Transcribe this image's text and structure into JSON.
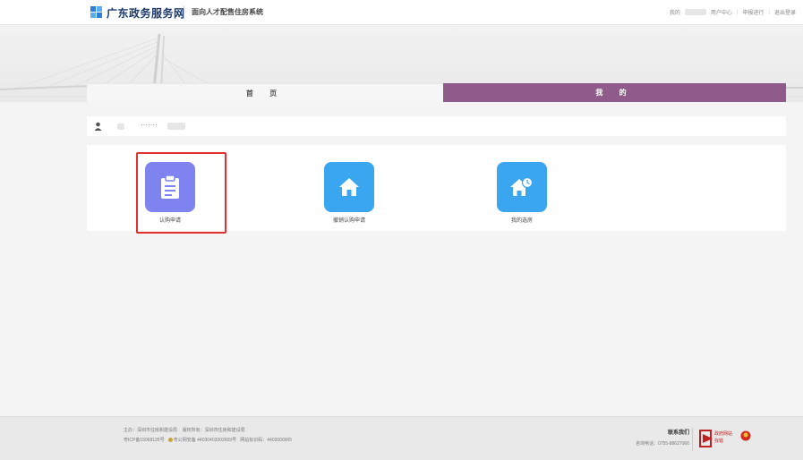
{
  "header": {
    "site_name": "广东政务服务网",
    "system_name": "面向人才配售住房系统",
    "links": [
      "我的",
      "用户中心",
      "申报进行",
      "退出登录"
    ]
  },
  "tabs": {
    "home": "首 页",
    "mine": "我 的"
  },
  "user": {
    "masked_id": "·······"
  },
  "apps": [
    {
      "label": "认购申请",
      "icon": "clipboard-icon"
    },
    {
      "label": "撤销认购申请",
      "icon": "home-icon"
    },
    {
      "label": "我的选房",
      "icon": "house-clock-icon"
    }
  ],
  "footer": {
    "host": "主办：深圳市住房和建设局",
    "owner": "版权所有：深圳市住房和建设局",
    "icp": "粤ICP备15068125号",
    "police": "粤公网安备 44030402002609号",
    "site_code": "网站标识码：4403000005",
    "contact_title": "联系我们",
    "hotline": "咨询电话：0755-88627066",
    "badge_line1": "政府网站",
    "badge_line2": "找错"
  },
  "colors": {
    "tab_active": "#8e5b8b",
    "tile_purple": "#7e83f0",
    "tile_blue": "#3aa6ef",
    "highlight": "#e03030",
    "brand_blue": "#1a3a6e"
  }
}
